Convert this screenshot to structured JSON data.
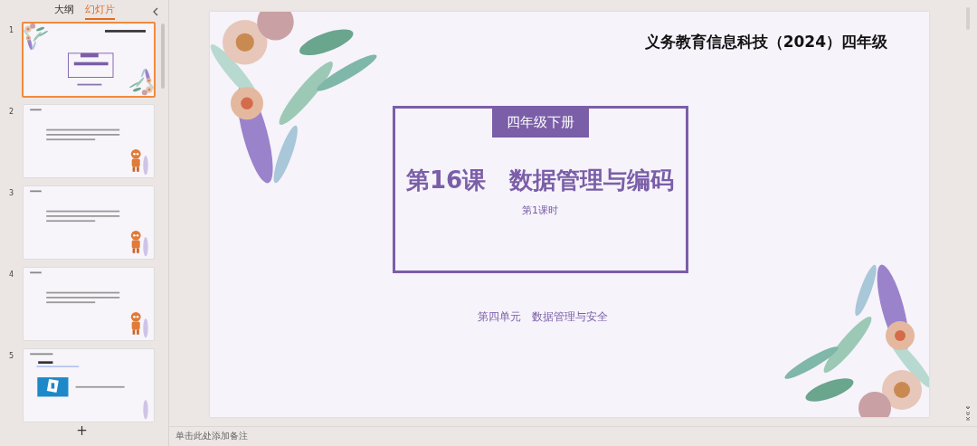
{
  "panel": {
    "tabs": [
      {
        "label": "大纲",
        "selected": false
      },
      {
        "label": "幻灯片",
        "selected": true
      }
    ],
    "thumbnails": [
      {
        "number": "1",
        "kind": "title",
        "selected": true
      },
      {
        "number": "2",
        "kind": "text",
        "selected": false
      },
      {
        "number": "3",
        "kind": "text",
        "selected": false
      },
      {
        "number": "4",
        "kind": "text",
        "selected": false
      },
      {
        "number": "5",
        "kind": "question",
        "selected": false
      }
    ],
    "add_label": "+"
  },
  "slide": {
    "title": "义务教育信息科技（2024）四年级",
    "tag": "四年级下册",
    "lesson": "第16课　数据管理与编码",
    "period": "第1课时",
    "unit": "第四单元　数据管理与安全"
  },
  "notes": {
    "placeholder": "单击此处添加备注"
  }
}
